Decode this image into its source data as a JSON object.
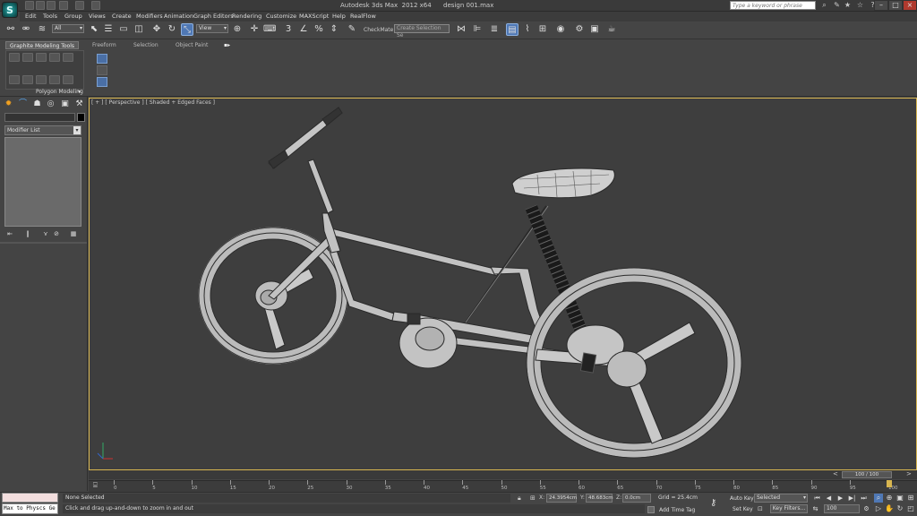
{
  "title_bar": {
    "app_title": "Autodesk 3ds Max  2012 x64      design 001.max",
    "search_placeholder": "Type a keyword or phrase"
  },
  "menu": [
    "Edit",
    "Tools",
    "Group",
    "Views",
    "Create",
    "Modifiers",
    "Animation",
    "Graph Editors",
    "Rendering",
    "Customize",
    "MAXScript",
    "Help",
    "RealFlow"
  ],
  "toolbar": {
    "selection_filter": "All",
    "ref_coord": "View",
    "checkmate_label": "CheckMate",
    "named_selection_placeholder": "Create Selection Se"
  },
  "ribbon": {
    "tabs": [
      "Graphite Modeling Tools",
      "Freeform",
      "Selection",
      "Object Paint"
    ],
    "panel_label": "Polygon Modeling"
  },
  "command_panel": {
    "modifier_list": "Modifier List"
  },
  "viewport": {
    "label": "[ + ] [ Perspective ] [ Shaded + Edged Faces ]"
  },
  "time_slider": {
    "frame_label": "100 / 100",
    "ticks": [
      "0",
      "5",
      "10",
      "15",
      "20",
      "25",
      "30",
      "35",
      "40",
      "45",
      "50",
      "55",
      "60",
      "65",
      "70",
      "75",
      "80",
      "85",
      "90",
      "95",
      "100"
    ]
  },
  "status_bar": {
    "maxscript_listener": "Max to Physcs Ge",
    "selection_status": "None Selected",
    "prompt": "Click and drag up-and-down to zoom in and out",
    "x_label": "X:",
    "x_value": "24.3954cm",
    "y_label": "Y:",
    "y_value": "48.683cm",
    "z_label": "Z:",
    "z_value": "0.0cm",
    "grid": "Grid = 25.4cm",
    "add_time_tag": "Add Time Tag",
    "auto_key": "Auto Key",
    "set_key": "Set Key",
    "key_mode": "Selected",
    "key_filters": "Key Filters...",
    "frame": "100"
  },
  "colors": {
    "viewport_border": "#d8b650",
    "active_tool": "#4f78b5",
    "mesh_wire": "#2a2a2a",
    "mesh_fill": "#cfcfcf"
  }
}
